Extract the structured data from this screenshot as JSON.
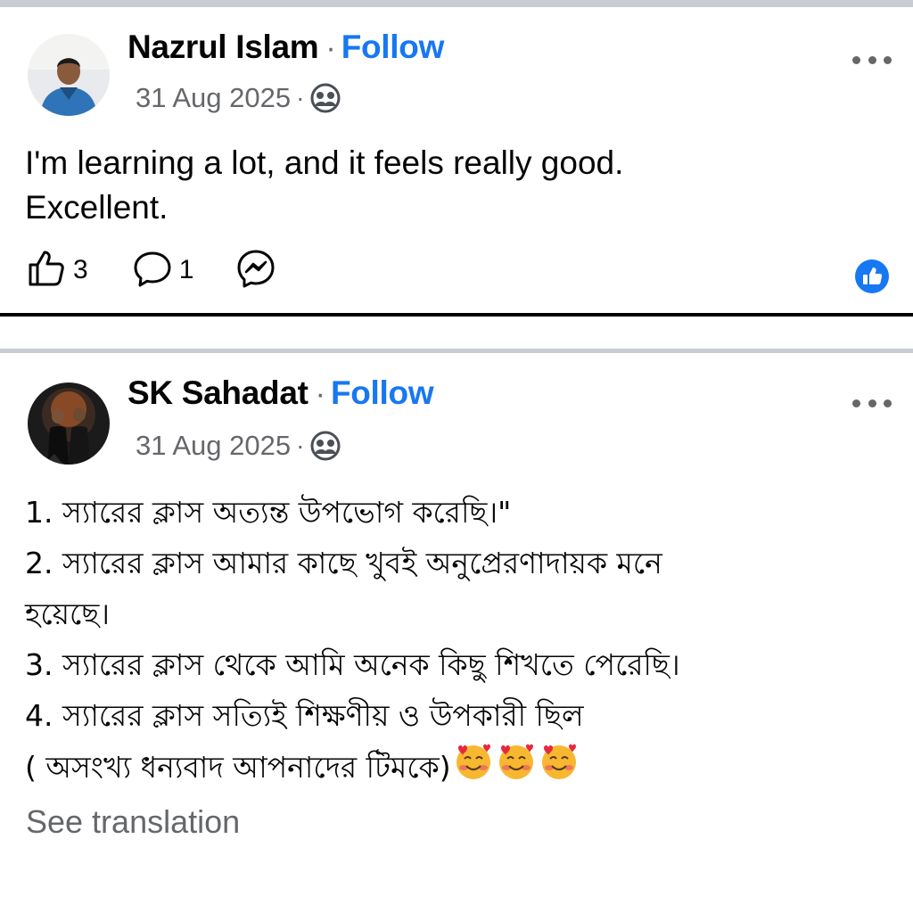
{
  "colors": {
    "link": "#1877f2",
    "secondary": "#65676b",
    "like_badge": "#1877f2"
  },
  "post1": {
    "author": "Nazrul Islam",
    "separator": "·",
    "follow_label": "Follow",
    "date": "31 Aug 2025",
    "meta_separator": "·",
    "audience_icon": "friends-icon",
    "text_lines": [
      "I'm learning a lot, and it feels really good.",
      "Excellent."
    ],
    "likes_count": "3",
    "comments_count": "1",
    "icons": [
      "like-icon",
      "comment-icon",
      "messenger-icon",
      "like-reaction-icon",
      "more-icon"
    ]
  },
  "post2": {
    "author": "SK Sahadat",
    "separator": "·",
    "follow_label": "Follow",
    "date": "31 Aug 2025",
    "meta_separator": "·",
    "audience_icon": "friends-icon",
    "text_lines": [
      "1. স্যারের ক্লাস অত্যন্ত উপভোগ করেছি।\"",
      "2. স্যারের ক্লাস আমার কাছে খুবই অনুপ্রেরণাদায়ক মনে",
      "হয়েছে।",
      "3. স্যারের ক্লাস থেকে আমি অনেক কিছু শিখতে পেরেছি।",
      "4. স্যারের ক্লাস সত্যিই শিক্ষণীয় ও উপকারী ছিল",
      "( অসংখ্য ধন্যবাদ আপনাদের টিমকে)"
    ],
    "emoji": "smiling-face-with-hearts",
    "see_translation": "See translation"
  }
}
